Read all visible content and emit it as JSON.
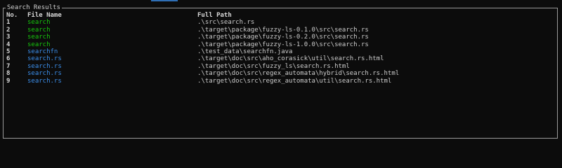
{
  "panel": {
    "title": "Search Results"
  },
  "table": {
    "headers": {
      "no": "No.",
      "file_name": "File Name",
      "full_path": "Full Path"
    },
    "rows": [
      {
        "no": "1",
        "file_name": "search",
        "full_path": ".\\src\\search.rs",
        "color": "#16c60c"
      },
      {
        "no": "2",
        "file_name": "search",
        "full_path": ".\\target\\package\\fuzzy-ls-0.1.0\\src\\search.rs",
        "color": "#16c60c"
      },
      {
        "no": "3",
        "file_name": "search",
        "full_path": ".\\target\\package\\fuzzy-ls-0.2.0\\src\\search.rs",
        "color": "#16c60c"
      },
      {
        "no": "4",
        "file_name": "search",
        "full_path": ".\\target\\package\\fuzzy-ls-1.0.0\\src\\search.rs",
        "color": "#16c60c"
      },
      {
        "no": "5",
        "file_name": "searchfn",
        "full_path": ".\\test_data\\searchfn.java",
        "color": "#3b8eea"
      },
      {
        "no": "6",
        "file_name": "search.rs",
        "full_path": ".\\target\\doc\\src\\aho_corasick\\util\\search.rs.html",
        "color": "#3b8eea"
      },
      {
        "no": "7",
        "file_name": "search.rs",
        "full_path": ".\\target\\doc\\src\\fuzzy_ls\\search.rs.html",
        "color": "#3b8eea"
      },
      {
        "no": "8",
        "file_name": "search.rs",
        "full_path": ".\\target\\doc\\src\\regex_automata\\hybrid\\search.rs.html",
        "color": "#3b8eea"
      },
      {
        "no": "9",
        "file_name": "search.rs",
        "full_path": ".\\target\\doc\\src\\regex_automata\\util\\search.rs.html",
        "color": "#3b8eea"
      }
    ]
  }
}
